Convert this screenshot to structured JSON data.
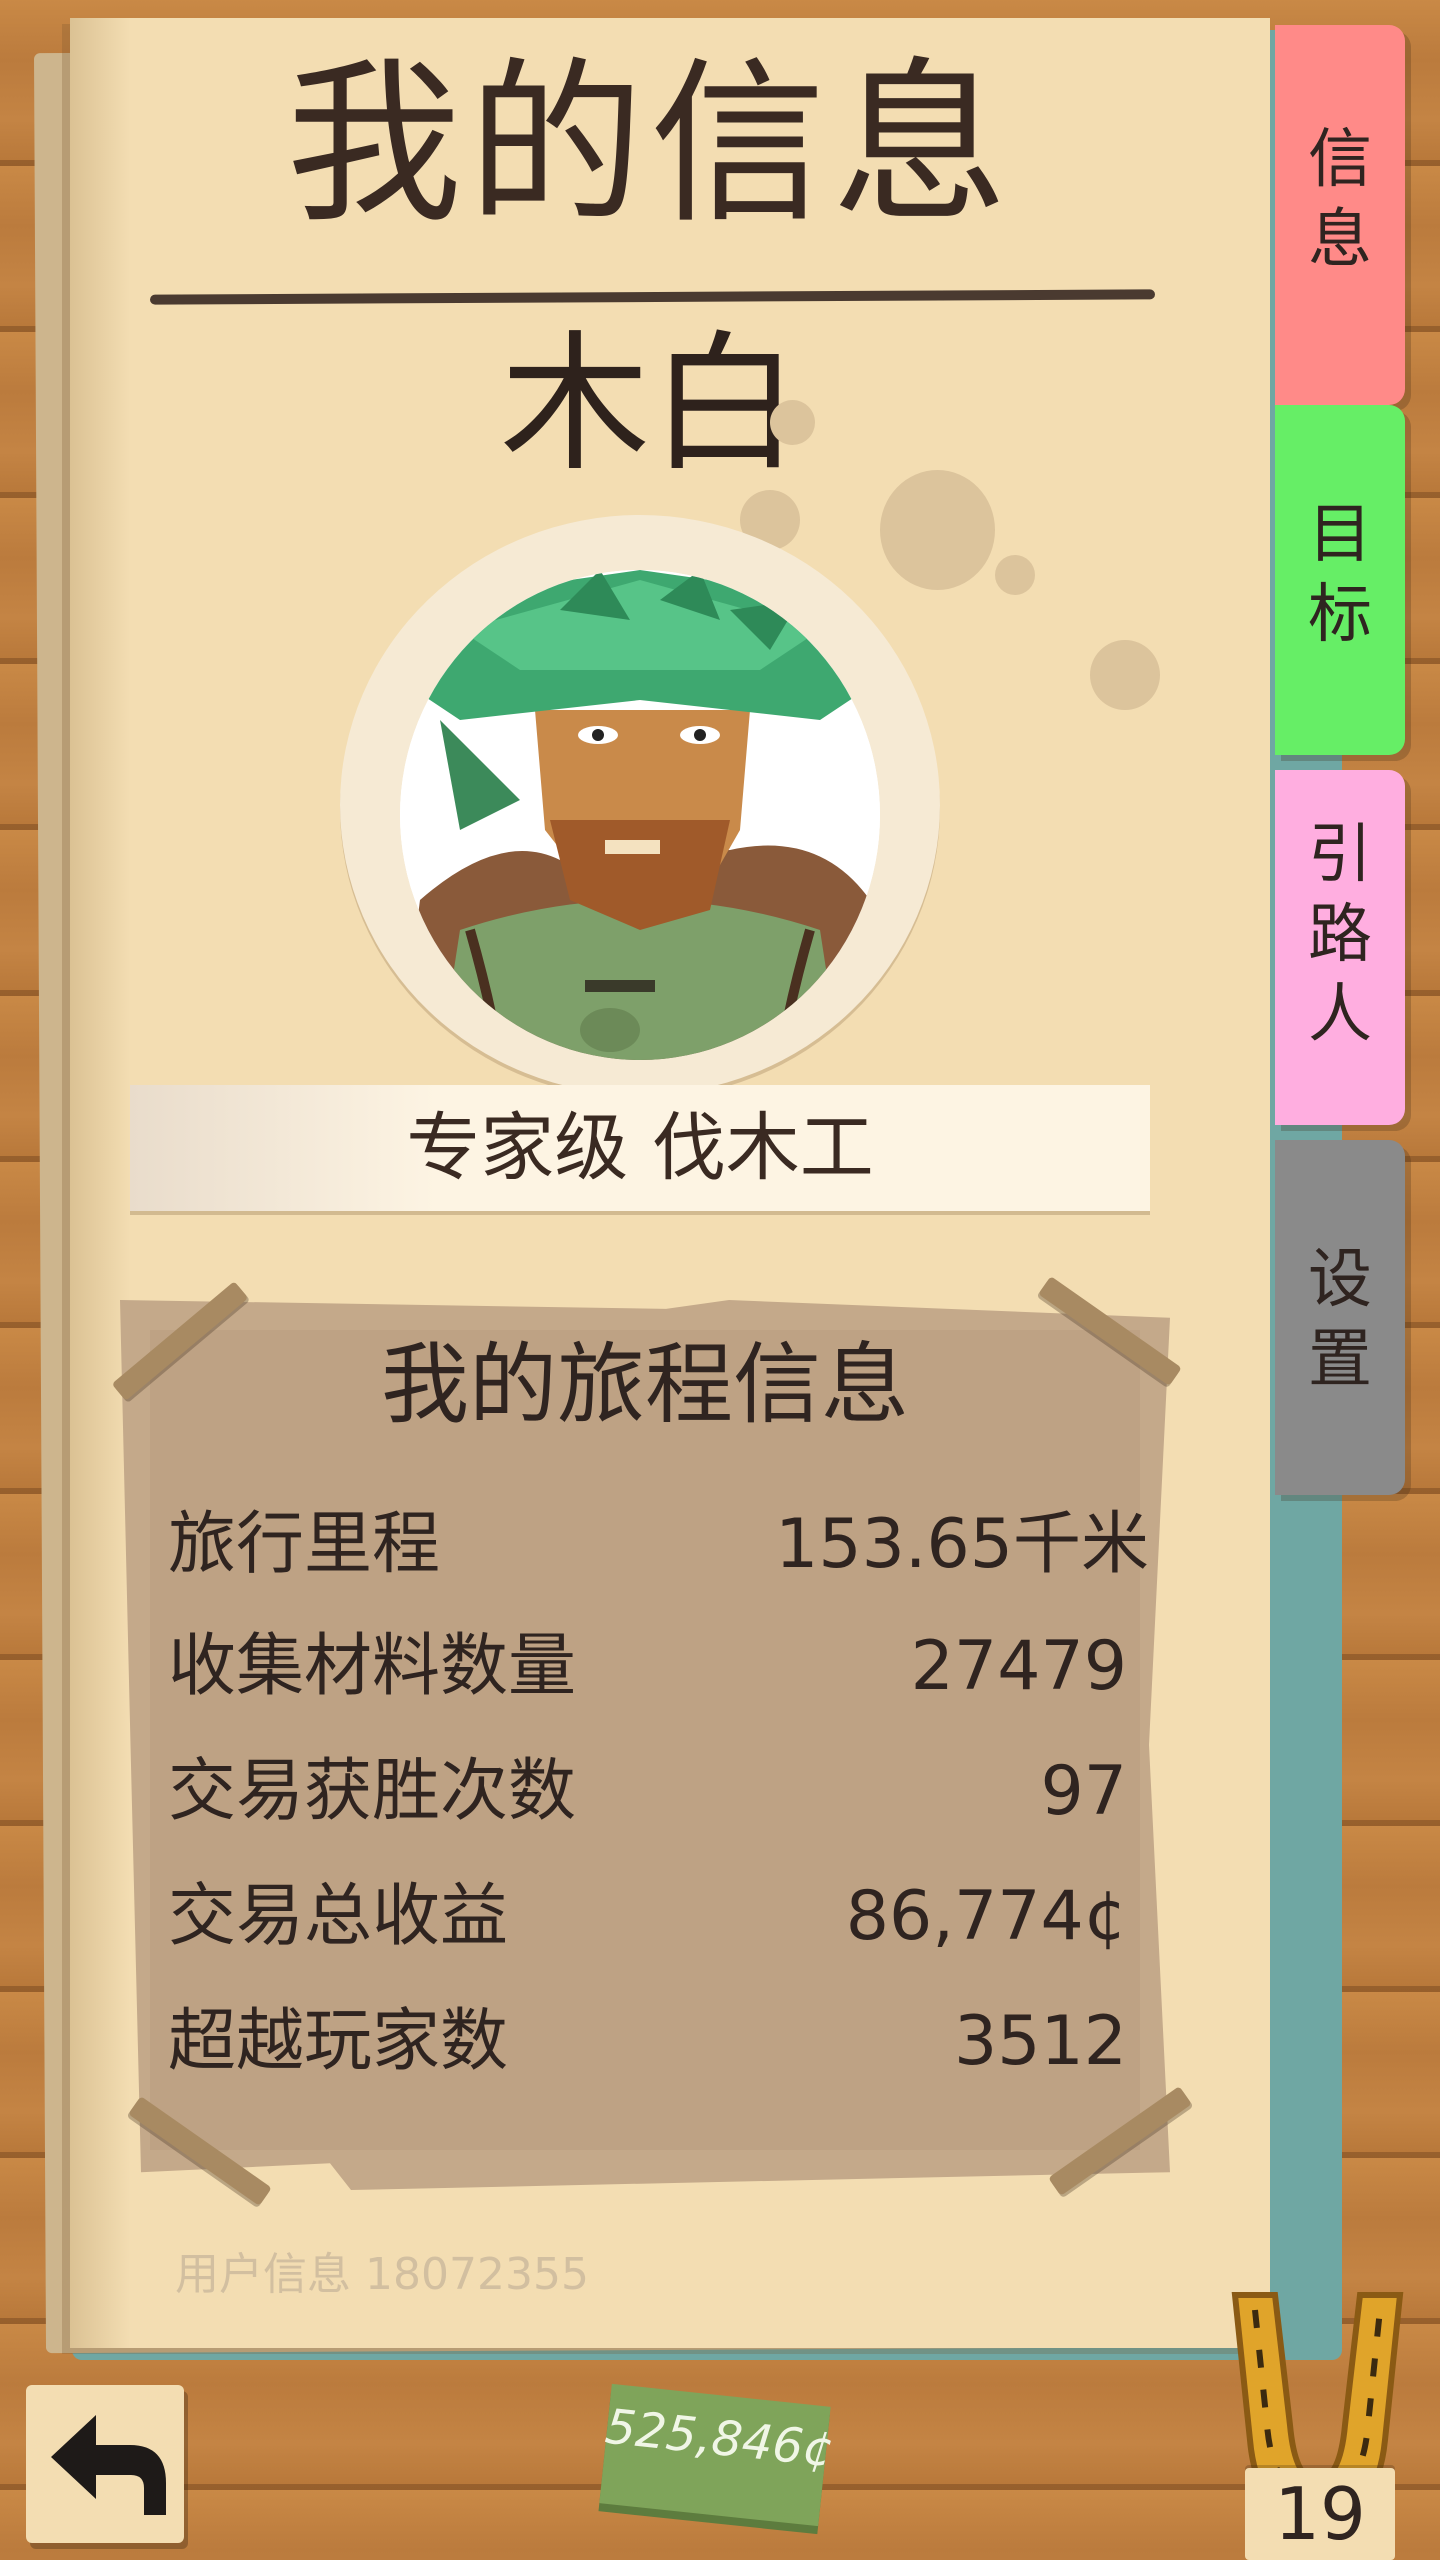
{
  "header": {
    "title": "我的信息",
    "player_name": "木白"
  },
  "profile": {
    "rank_title": "专家级 伐木工"
  },
  "journey": {
    "title": "我的旅程信息",
    "stats": [
      {
        "label": "旅行里程",
        "value": "153.65千米"
      },
      {
        "label": "收集材料数量",
        "value": "27479"
      },
      {
        "label": "交易获胜次数",
        "value": "97"
      },
      {
        "label": "交易总收益",
        "value": "86,774¢"
      },
      {
        "label": "超越玩家数",
        "value": "3512"
      }
    ]
  },
  "footer": {
    "user_info": "用户信息 18072355"
  },
  "tabs": [
    {
      "lines": [
        "信",
        "息"
      ],
      "color": "#ff8a88",
      "active": true
    },
    {
      "lines": [
        "目",
        "标"
      ],
      "color": "#66ee66"
    },
    {
      "lines": [
        "引",
        "路",
        "人"
      ],
      "color": "#ffaee0"
    },
    {
      "lines": [
        "设",
        "置"
      ],
      "color": "#8a8a8a"
    }
  ],
  "bottom_bar": {
    "back_icon": "back-arrow-icon",
    "money": "525,846¢",
    "level_icon": "horseshoe-icon",
    "level": "19"
  }
}
